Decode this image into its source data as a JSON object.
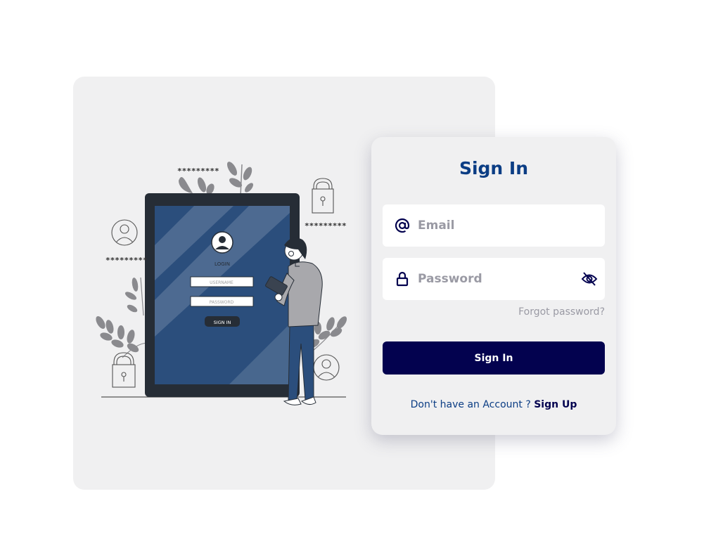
{
  "illustration": {
    "mini_form": {
      "heading": "LOGIN",
      "username_placeholder": "USERNAME",
      "password_placeholder": "PASSWORD",
      "button_label": "SIGN IN"
    },
    "masked_text_1": "*********",
    "masked_text_2": "*********",
    "masked_text_3": "*********"
  },
  "signin_card": {
    "title": "Sign In",
    "email": {
      "placeholder": "Email",
      "value": "",
      "icon": "at-sign-icon"
    },
    "password": {
      "placeholder": "Password",
      "value": "",
      "icon": "lock-icon",
      "toggle_icon": "eye-off-icon"
    },
    "forgot_label": "Forgot password?",
    "submit_label": "Sign In",
    "signup_prompt": "Don't have an Account ?",
    "signup_link": "Sign Up"
  },
  "colors": {
    "title": "#0b3d84",
    "button_bg": "#03024f",
    "panel_bg": "#f0f0f1",
    "muted_text": "#9a9aa4",
    "tablet_screen": "#2b4e7c",
    "tablet_frame": "#262d36"
  }
}
